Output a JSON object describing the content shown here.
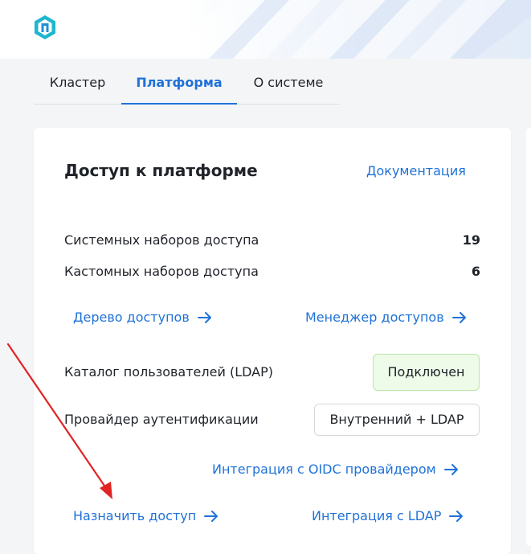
{
  "header": {
    "logo_icon": "brand-logo-icon"
  },
  "tabs": [
    {
      "label": "Кластер",
      "active": false
    },
    {
      "label": "Платформа",
      "active": true
    },
    {
      "label": "О системе",
      "active": false
    }
  ],
  "card": {
    "title": "Доступ к платформе",
    "docs_link": "Документация",
    "stats": [
      {
        "label": "Системных наборов доступа",
        "value": "19"
      },
      {
        "label": "Кастомных наборов доступа",
        "value": "6"
      }
    ],
    "links": {
      "access_tree": "Дерево доступов",
      "access_manager": "Менеджер доступов",
      "oidc_integration": "Интеграция с OIDC провайдером",
      "assign_access": "Назначить доступ",
      "ldap_integration": "Интеграция с LDAP"
    },
    "ldap_catalog": {
      "label": "Каталог пользователей (LDAP)",
      "status": "Подключен"
    },
    "auth_provider": {
      "label": "Провайдер аутентификации",
      "value": "Внутренний + LDAP"
    }
  },
  "colors": {
    "accent": "#1f72d8",
    "success_bg": "#eefbe9",
    "success_border": "#b9e6a5",
    "annotation_arrow": "#e02424"
  }
}
